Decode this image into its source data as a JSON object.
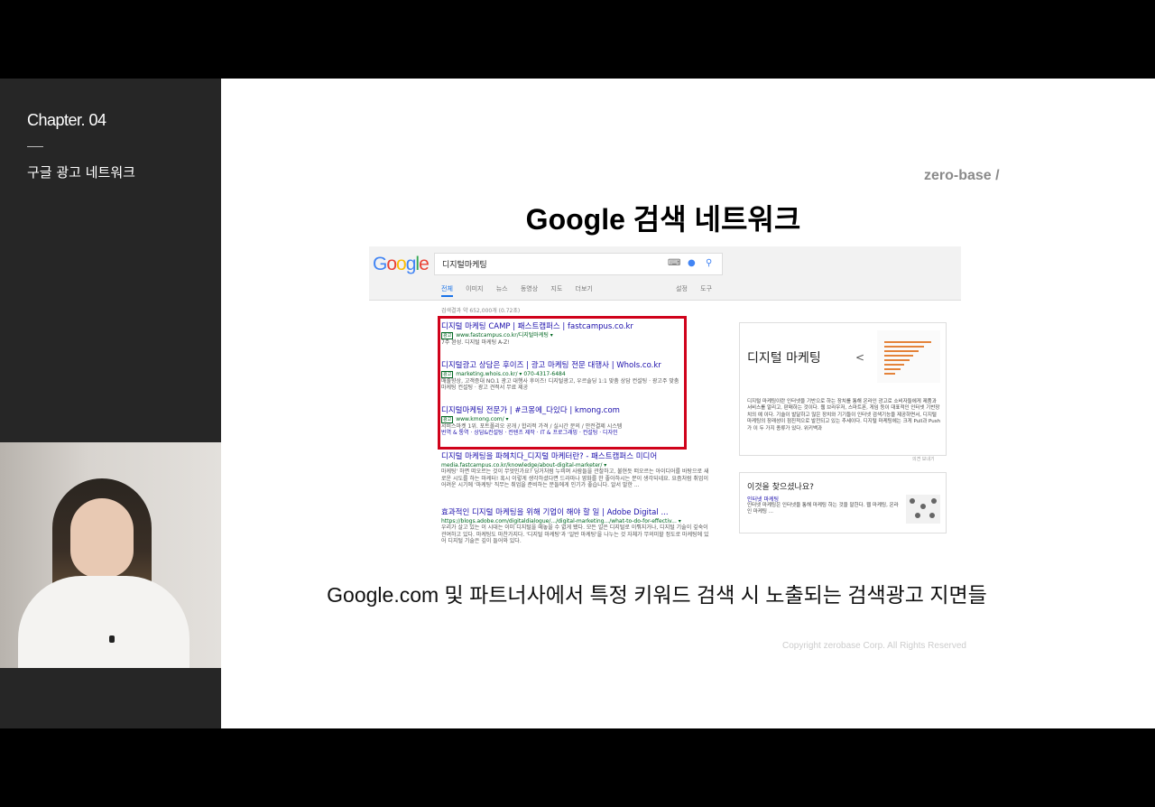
{
  "sidebar": {
    "chapter": "Chapter. 04",
    "subtitle": "구글 광고 네트워크"
  },
  "slide": {
    "logo": "zero-base /",
    "title": "Google 검색 네트워크",
    "caption": "Google.com 및 파트너사에서 특정 키워드 검색 시 노출되는 검색광고 지면들",
    "copyright": "Copyright zerobase Corp. All Rights Reserved"
  },
  "serp": {
    "logo_letters": [
      "G",
      "o",
      "o",
      "g",
      "l",
      "e"
    ],
    "query": "디지털마케팅",
    "tabs": [
      "전체",
      "이미지",
      "뉴스",
      "동영상",
      "지도",
      "더보기"
    ],
    "tabs_right": [
      "설정",
      "도구"
    ],
    "result_count": "검색결과 약 652,000개 (0.72초)",
    "ads": [
      {
        "title": "디지털 마케팅 CAMP | 패스트캠퍼스 | fastcampus.co.kr",
        "url": "www.fastcampus.co.kr/디지털마케팅 ▾",
        "desc": "7주 완성. 디지털 마케팅 A-Z!"
      },
      {
        "title": "디지털광고 상담은 후이즈 | 광고 마케팅 전문 대행사 | WhoIs.co.kr",
        "url": "marketing.whois.co.kr/ ▾   070-4317-6484",
        "desc": "매출향상, 고객증대 NO.1 광고 대행사 후이즈! 디지털광고, 우르솔딩 1:1 맞춤 상담 컨설팅 · 광고주 맞춤 마케팅 컨설팅 · 광고 견적서 무료 제공"
      },
      {
        "title": "디지털마케팅 전문가 | #크몽에_다있다 | kmong.com",
        "url": "www.kmong.com/ ▾",
        "desc": "서비스마켓 1위. 포트폴리오 공개 / 합리적 가격 / 실시간 문의 / 안전결제 시스템",
        "links": "번역 & 통역 · 상담&컨설팅 · 컨텐츠 제작 · IT & 프로그래밍 · 컨설팅 · 디자인"
      }
    ],
    "organic": [
      {
        "title": "디지털 마케팅을 파헤치다_디지털 마케터란? - 패스트캠퍼스 미디어",
        "url": "media.fastcampus.co.kr/knowledge/about-digital-marketer/ ▾",
        "desc": "마케팅' 하면 떠오르는 것이 무엇인가요? 딩거처럼 누비며 사람들을 관찰하고, 불현듯 떠오르는 아이디어를 바탕으로 새로운 시도를 하는 마케터! 혹시 이렇게 생각하셨다면 드라마나 영화를 한 좋아하시는 분이 생각되네요. 요즘처럼 취업이 어려운 시기에 '마케팅' 직무는 취업을 준비하는 분들에게 인기가 좋습니다. 알서 말한 ..."
      },
      {
        "title": "효과적인 디지털 마케팅을 위해 기업이 해야 할 일 | Adobe Digital ...",
        "url": "https://blogs.adobe.com/digitaldialogue/.../digital-marketing.../what-to-do-for-effectiv... ▾",
        "desc": "우리가 살고 있는 이 시대는 이미 디지털을 떼놓을 수 없게 됐다. 모든 일은 디지털로 이뤄지거나, 디지털 기술이 깊숙이 관여하고 있다. 마케팅도 마찬가지다. '디지털 마케팅'과 '일반 마케팅'을 나누는 것 자체가 무의미할 정도로 마케팅에 있어 디지털 기술은 깊이 들어와 있다."
      }
    ],
    "knowledge_panel": {
      "title": "디지털 마케팅",
      "share": "<",
      "desc": "디지털 마케팅이란 인터넷을 기반으로 하는 장치를 통해 온라인 광고로 소비자들에게 제품과 서비스를 알리고, 판매하는 것이다. 웹 브라우저, 스마트폰, 게임 등이 대표적인 인터넷 기반장치의 예 이다. 기술이 발달하고 많은 장치와 기기들이 인터넷 검색기능을 제공하면서, 디지털 마케팅의 장래성이 점진적으로 발전되고 있는 추세이다. 디지털 마케팅에는 크게 Pull과 Push가 이 두 가지 종류가 있다. 위키백과",
      "footer": "의견 보내기"
    },
    "people_also": {
      "heading": "이것을 찾으셨나요?",
      "link": "인터넷 마케팅",
      "desc": "인터넷 마케팅은 인터넷을 통해 마케팅 하는 것을 말한다. 웹 마케팅, 온라인 마케팅 ..."
    }
  }
}
